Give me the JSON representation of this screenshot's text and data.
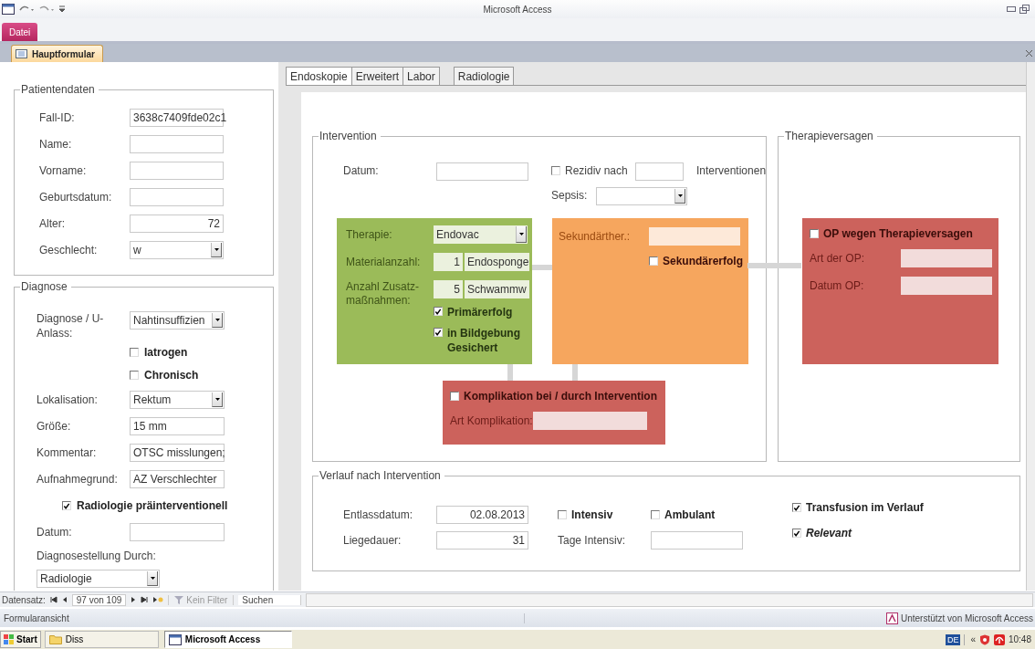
{
  "window": {
    "title": "Microsoft Access"
  },
  "file_tab": "Datei",
  "document_tab": "Hauptformular",
  "tabs": [
    {
      "label": "Endoskopie",
      "selected": true
    },
    {
      "label": "Erweitert",
      "selected": false
    },
    {
      "label": "Labor",
      "selected": false
    },
    {
      "label": "Radiologie",
      "selected": false
    }
  ],
  "patientendaten": {
    "title": "Patientendaten",
    "fields": [
      {
        "kind": "text",
        "label": "Fall-ID:",
        "value": "3638c7409fde02c1"
      },
      {
        "kind": "text",
        "label": "Name:"
      },
      {
        "kind": "text",
        "label": "Vorname:"
      },
      {
        "kind": "text",
        "label": "Geburtsdatum:"
      },
      {
        "kind": "number",
        "label": "Alter:",
        "value": "72"
      },
      {
        "kind": "combo",
        "label": "Geschlecht:",
        "value": "w"
      }
    ]
  },
  "diagnose": {
    "title": "Diagnose",
    "items": [
      {
        "kind": "combo",
        "label": "Diagnose / U-Anlass:",
        "value": "Nahtinsuffizien"
      },
      {
        "kind": "check",
        "label": "Iatrogen",
        "checked": false
      },
      {
        "kind": "check",
        "label": "Chronisch",
        "checked": false
      },
      {
        "kind": "combo",
        "label": "Lokalisation:",
        "value": "Rektum"
      },
      {
        "kind": "text",
        "label": "Größe:",
        "value": "15 mm"
      },
      {
        "kind": "text",
        "label": "Kommentar:",
        "value": "OTSC misslungen;"
      },
      {
        "kind": "text",
        "label": "Aufnahmegrund:",
        "value": "AZ Verschlechter"
      },
      {
        "kind": "check_wide",
        "label": "Radiologie präinterventionell",
        "checked": true
      },
      {
        "kind": "text",
        "label": "Datum:"
      },
      {
        "kind": "caption",
        "label": "Diagnosestellung Durch:"
      },
      {
        "kind": "combo_full",
        "value": "Radiologie"
      }
    ]
  },
  "intervention": {
    "title": "Intervention",
    "datum_label": "Datum:",
    "rezidiv": {
      "label": "Rezidiv nach",
      "checked": false,
      "suffix": "Interventionen"
    },
    "sepsis": {
      "label": "Sepsis:"
    },
    "therapie": {
      "label": "Therapie:",
      "value": "Endovac",
      "material": {
        "label": "Materialanzahl:",
        "count": "1",
        "value": "Endosponge"
      },
      "zusatz": {
        "label": "Anzahl Zusatz-maßnahmen:",
        "count": "5",
        "value": "Schwammw"
      },
      "checks": [
        {
          "label": "Primärerfolg",
          "checked": true
        },
        {
          "label": "in Bildgebung Gesichert",
          "checked": true
        }
      ]
    },
    "sekundaer": {
      "label": "Sekundärther.:",
      "check": {
        "label": "Sekundärerfolg",
        "checked": false
      }
    },
    "komplikation": {
      "check": {
        "label": "Komplikation bei / durch Intervention",
        "checked": false
      },
      "art_label": "Art Komplikation:"
    }
  },
  "therapieversagen": {
    "title": "Therapieversagen",
    "check": {
      "label": "OP wegen Therapieversagen",
      "checked": false
    },
    "fields": [
      "Art der OP:",
      "Datum OP:"
    ]
  },
  "verlauf": {
    "title": "Verlauf nach Intervention",
    "entlassdatum": {
      "label": "Entlassdatum:",
      "value": "02.08.2013"
    },
    "liegedauer": {
      "label": "Liegedauer:",
      "value": "31"
    },
    "intensiv": {
      "label": "Intensiv",
      "checked": false
    },
    "ambulant": {
      "label": "Ambulant",
      "checked": false
    },
    "tage_intensiv": {
      "label": "Tage Intensiv:"
    },
    "transfusion": {
      "label": "Transfusion im Verlauf",
      "checked": true
    },
    "relevant": {
      "label": "Relevant",
      "checked": true
    }
  },
  "record_nav": {
    "label": "Datensatz:",
    "position": "97 von 109",
    "filter": "Kein Filter",
    "search": "Suchen"
  },
  "status_bar": {
    "left": "Formularansicht",
    "right": "Unterstützt von Microsoft Access"
  },
  "taskbar": {
    "start": "Start",
    "items": [
      {
        "label": "Diss",
        "selected": false
      },
      {
        "label": "Microsoft Access",
        "selected": true
      }
    ],
    "tray": {
      "language": "DE",
      "arrows": "«",
      "time": "10:48"
    }
  }
}
